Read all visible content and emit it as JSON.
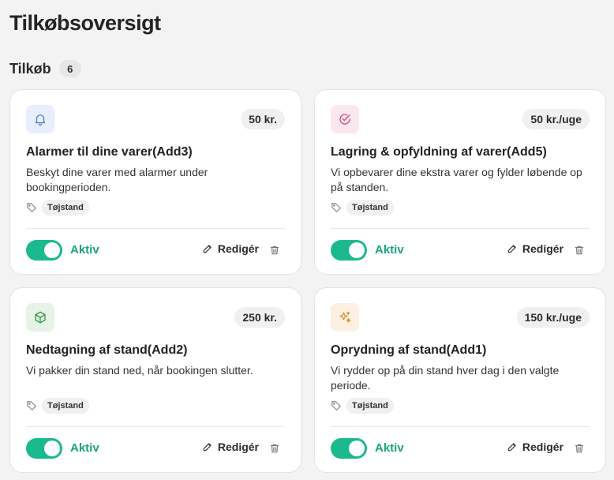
{
  "page": {
    "title": "Tilkøbsoversigt"
  },
  "section": {
    "title": "Tilkøb",
    "count": "6"
  },
  "colors": {
    "accent": "#1ab98e",
    "accent_text": "#17a67d",
    "icon_bg_blue": "#e6effb",
    "icon_bg_pink": "#fbe8ef",
    "icon_bg_green": "#e6f3e6",
    "icon_bg_orange": "#fbf0e2"
  },
  "cards": [
    {
      "icon": "bell-icon",
      "price": "50 kr.",
      "title": "Alarmer til dine varer(Add3)",
      "description": "Beskyt dine varer med alarmer under bookingperioden.",
      "tag": "Tøjstand",
      "status": "Aktiv",
      "edit_label": "Redigér"
    },
    {
      "icon": "check-circle-icon",
      "price": "50 kr./uge",
      "title": "Lagring & opfyldning af varer(Add5)",
      "description": "Vi opbevarer dine ekstra varer og fylder løbende op på standen.",
      "tag": "Tøjstand",
      "status": "Aktiv",
      "edit_label": "Redigér"
    },
    {
      "icon": "box-icon",
      "price": "250 kr.",
      "title": "Nedtagning af stand(Add2)",
      "description": "Vi pakker din stand ned, når bookingen slutter.",
      "tag": "Tøjstand",
      "status": "Aktiv",
      "edit_label": "Redigér"
    },
    {
      "icon": "sparkles-icon",
      "price": "150 kr./uge",
      "title": "Oprydning af stand(Add1)",
      "description": "Vi rydder op på din stand hver dag i den valgte periode.",
      "tag": "Tøjstand",
      "status": "Aktiv",
      "edit_label": "Redigér"
    }
  ]
}
